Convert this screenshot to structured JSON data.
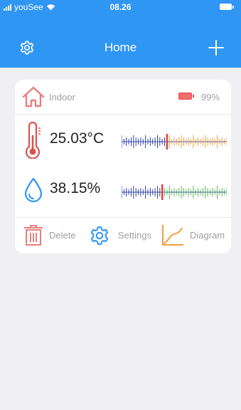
{
  "status_bar": {
    "carrier": "youSee",
    "time": "08.26",
    "icons": [
      "signal-icon",
      "wifi-icon",
      "battery-icon"
    ]
  },
  "nav": {
    "title": "Home",
    "left_icon": "gear-icon",
    "right_icon": "plus-icon"
  },
  "device": {
    "name": "Indoor",
    "name_icon": "house-icon",
    "battery_percent": "99%",
    "battery_icon": "battery-icon",
    "temperature": {
      "value": "25.03°C",
      "icon": "thermometer-icon",
      "gauge_icon": "gauge-scale-icon"
    },
    "humidity": {
      "value": "38.15%",
      "icon": "water-drop-icon",
      "gauge_icon": "gauge-scale-icon"
    },
    "actions": [
      {
        "label": "Delete",
        "icon": "trash-icon"
      },
      {
        "label": "Settings",
        "icon": "gear-icon"
      },
      {
        "label": "Diagram",
        "icon": "chart-icon"
      }
    ]
  },
  "colors": {
    "brand_blue": "#2f96f3",
    "house_red": "#e87f7f",
    "thermometer_red": "#d9534f",
    "water_blue": "#2f96f3",
    "gauge_blue": "#3344a8",
    "gauge_orange": "#f0a040",
    "gauge_green": "#5cb85c",
    "gauge_marker": "#e0433a",
    "diagram_orange": "#f0a040",
    "background": "#efeff4"
  }
}
